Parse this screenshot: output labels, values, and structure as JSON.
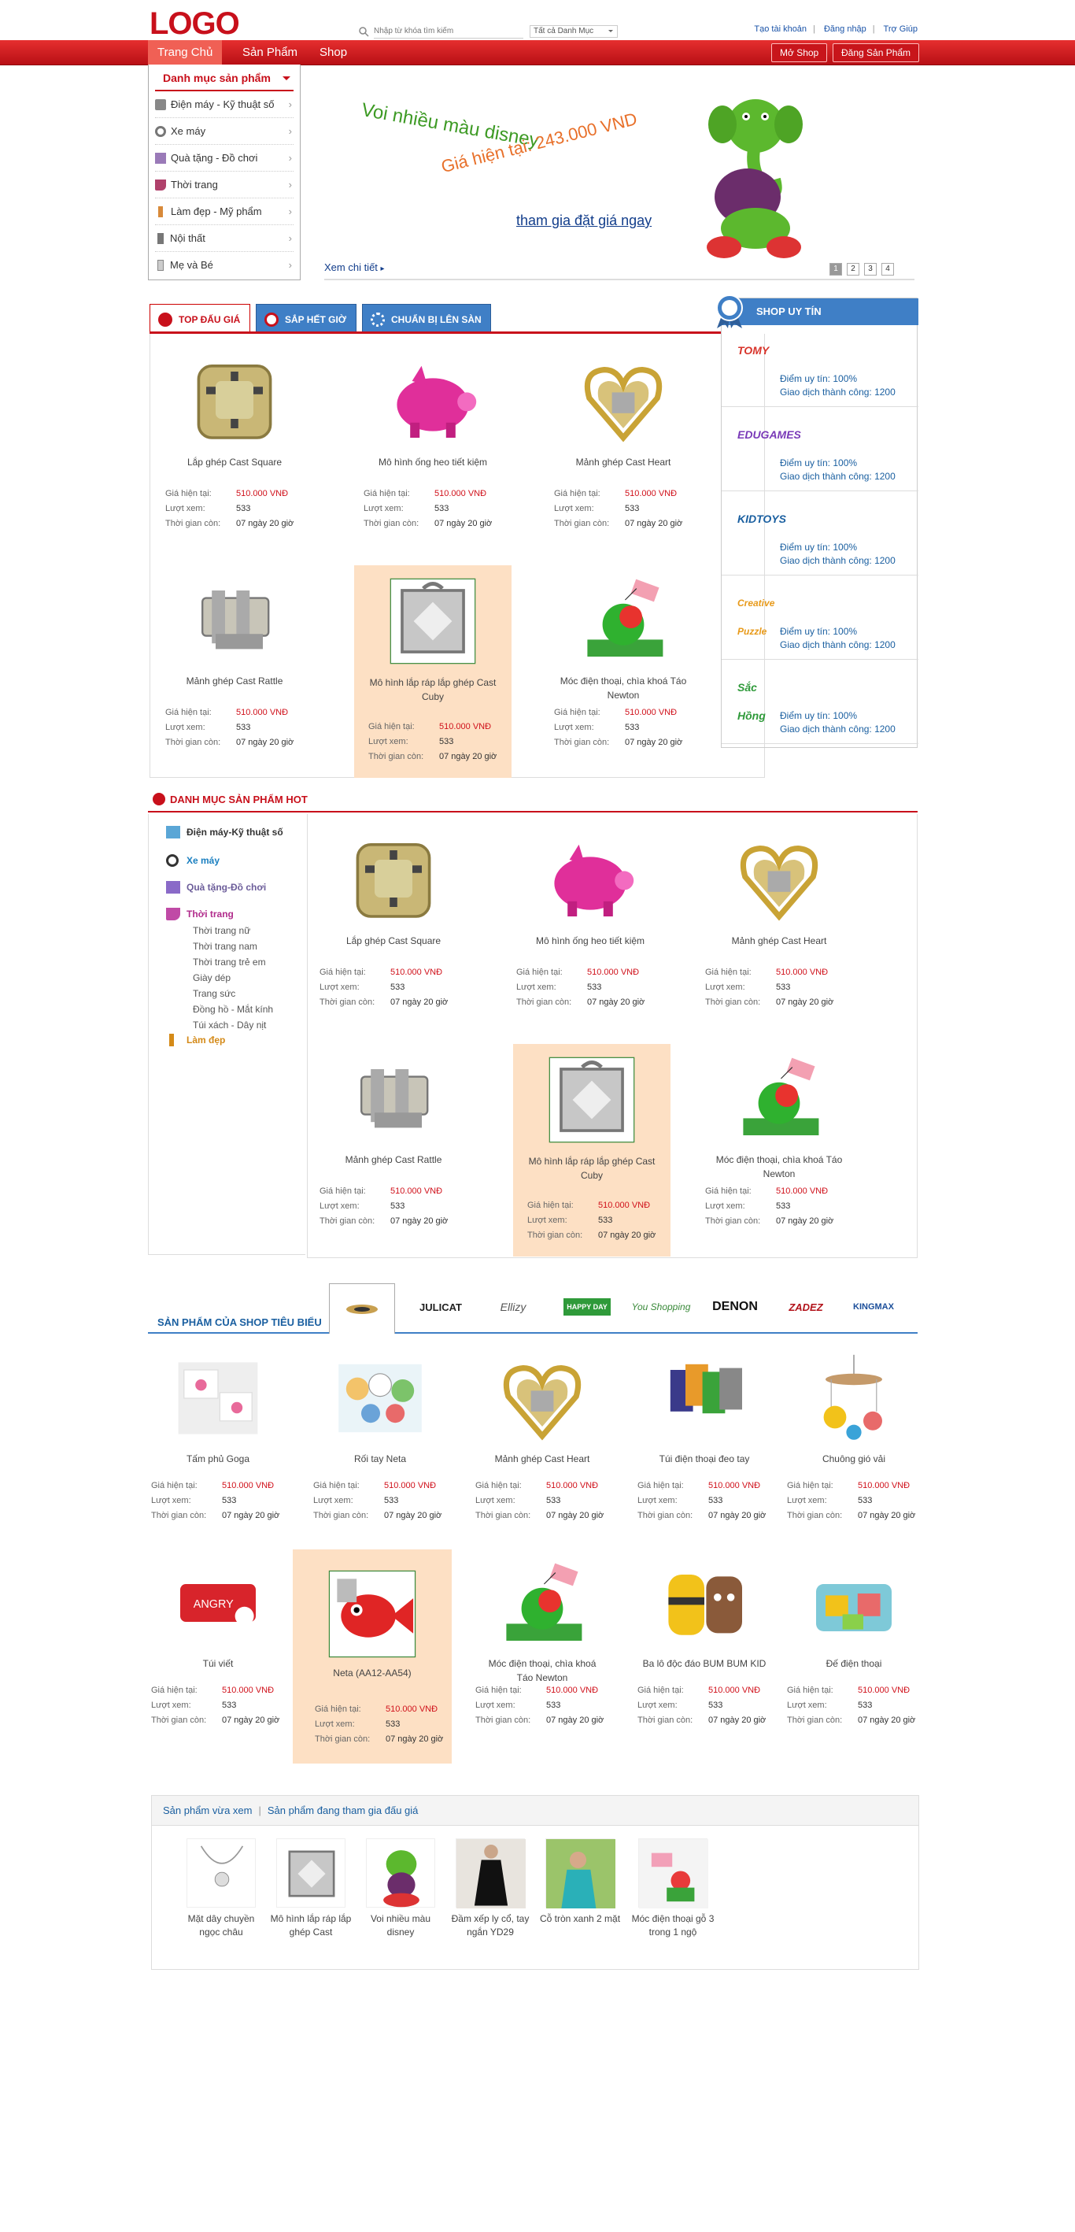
{
  "header": {
    "logo": "LOGO",
    "search_placeholder": "Nhập từ khóa tìm kiếm",
    "category_select": "Tất cả Danh Mục",
    "links": [
      "Tạo tài khoản",
      "Đăng nhập",
      "Trợ Giúp"
    ]
  },
  "nav": {
    "items": [
      "Trang Chủ",
      "Sản Phẩm",
      "Shop"
    ],
    "open_shop": "Mở Shop",
    "post_product": "Đăng Sản Phẩm"
  },
  "categories": {
    "title": "Danh mục sản phẩm",
    "items": [
      "Điện máy - Kỹ thuật số",
      "Xe máy",
      "Quà tặng - Đồ chơi",
      "Thời trang",
      "Làm đẹp - Mỹ phẩm",
      "Nội thất",
      "Mẹ và Bé"
    ]
  },
  "banner": {
    "title": "Voi nhiều màu disney",
    "price": "Giá hiện tại: 243.000 VND",
    "cta": "tham gia đặt giá ngay",
    "more": "Xem chi tiết",
    "pages": [
      "1",
      "2",
      "3",
      "4"
    ]
  },
  "auction_tabs": [
    "TOP ĐẤU GIÁ",
    "SẮP HẾT GIỜ",
    "CHUẨN BỊ LÊN SÀN"
  ],
  "labels": {
    "price": "Giá hiện tại:",
    "views": "Lượt xem:",
    "time": "Thời gian còn:"
  },
  "top_products": [
    {
      "name": "Lắp ghép Cast Square",
      "price": "510.000 VNĐ",
      "views": "533",
      "time": "07 ngày 20 giờ"
    },
    {
      "name": "Mô hình ống heo tiết kiệm",
      "price": "510.000 VNĐ",
      "views": "533",
      "time": "07 ngày 20 giờ"
    },
    {
      "name": "Mảnh ghép Cast Heart",
      "price": "510.000 VNĐ",
      "views": "533",
      "time": "07 ngày 20 giờ"
    },
    {
      "name": "Mảnh ghép Cast Rattle",
      "price": "510.000 VNĐ",
      "views": "533",
      "time": "07 ngày 20 giờ"
    },
    {
      "name": "Mô hình lắp ráp lắp ghép Cast Cuby",
      "price": "510.000 VNĐ",
      "views": "533",
      "time": "07 ngày 20 giờ"
    },
    {
      "name": "Móc điện thoại, chìa khoá Táo Newton",
      "price": "510.000 VNĐ",
      "views": "533",
      "time": "07 ngày 20 giờ"
    }
  ],
  "shops": {
    "title": "SHOP UY TÍN",
    "items": [
      {
        "logo": "TOMY",
        "score": "Điểm uy tín: 100%",
        "deals": "Giao dịch thành công: 1200"
      },
      {
        "logo": "EDUGAMES",
        "score": "Điểm uy tín: 100%",
        "deals": "Giao dịch thành công: 1200"
      },
      {
        "logo": "KIDTOYS",
        "score": "Điểm uy tín: 100%",
        "deals": "Giao dịch thành công: 1200"
      },
      {
        "logo": "Creative Puzzle",
        "score": "Điểm uy tín: 100%",
        "deals": "Giao dịch thành công: 1200"
      },
      {
        "logo": "Sắc Hồng",
        "score": "Điểm uy tín: 100%",
        "deals": "Giao dịch thành công: 1200"
      }
    ]
  },
  "hot": {
    "title": "DANH MỤC SẢN PHẨM HOT",
    "sidebar": [
      "Điện máy-Kỹ thuật số",
      "Xe máy",
      "Quà tặng-Đồ chơi",
      "Thời trang",
      "Làm đẹp"
    ],
    "fashion_sub": [
      "Thời trang nữ",
      "Thời trang nam",
      "Thời trang trẻ em",
      "Giày dép",
      "Trang sức",
      "Đồng hồ - Mắt kính",
      "Túi xách - Dây nịt"
    ]
  },
  "shop_featured": {
    "title": "SẢN PHẨM CỦA SHOP TIÊU BIỂU",
    "brands": [
      "JULICAT",
      "Ellizy",
      "HAPPY DAY",
      "You Shopping",
      "DENON",
      "ZADEZ",
      "KINGMAX"
    ],
    "products": [
      {
        "name": "Tấm phủ Goga",
        "price": "510.000 VNĐ",
        "views": "533",
        "time": "07 ngày 20 giờ"
      },
      {
        "name": "Rối tay Neta",
        "price": "510.000 VNĐ",
        "views": "533",
        "time": "07 ngày 20 giờ"
      },
      {
        "name": "Mảnh ghép Cast Heart",
        "price": "510.000 VNĐ",
        "views": "533",
        "time": "07 ngày 20 giờ"
      },
      {
        "name": "Túi điện thoại đeo tay",
        "price": "510.000 VNĐ",
        "views": "533",
        "time": "07 ngày 20 giờ"
      },
      {
        "name": "Chuông gió vải",
        "price": "510.000 VNĐ",
        "views": "533",
        "time": "07 ngày 20 giờ"
      },
      {
        "name": "Túi viết",
        "price": "510.000 VNĐ",
        "views": "533",
        "time": "07 ngày 20 giờ"
      },
      {
        "name": "Neta (AA12-AA54)",
        "price": "510.000 VNĐ",
        "views": "533",
        "time": "07 ngày 20 giờ"
      },
      {
        "name": "Móc điện thoại, chìa khoá Táo Newton",
        "price": "510.000 VNĐ",
        "views": "533",
        "time": "07 ngày 20 giờ"
      },
      {
        "name": "Ba lô độc đáo BUM BUM KID",
        "price": "510.000 VNĐ",
        "views": "533",
        "time": "07 ngày 20 giờ"
      },
      {
        "name": "Đế điện thoại",
        "price": "510.000 VNĐ",
        "views": "533",
        "time": "07 ngày 20 giờ"
      }
    ]
  },
  "recent": {
    "tab1": "Sản phẩm vừa xem",
    "tab2": "Sản phẩm đang tham gia đấu giá",
    "items": [
      "Mặt dây chuyền ngọc châu",
      "Mô hình lắp ráp lắp ghép Cast",
      "Voi nhiều màu disney",
      "Đầm xếp ly cổ, tay ngắn YD29",
      "Cỗ tròn xanh 2 mặt",
      "Móc điện thoại gỗ 3 trong 1 ngộ"
    ]
  },
  "colors": {
    "brand_red": "#c8101b",
    "accent_blue": "#3f7fc6",
    "highlight": "#fde0c4"
  }
}
